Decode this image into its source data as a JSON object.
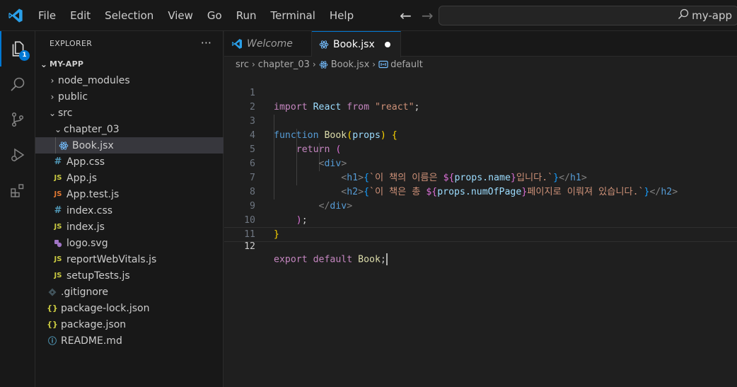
{
  "menu": [
    "File",
    "Edit",
    "Selection",
    "View",
    "Go",
    "Run",
    "Terminal",
    "Help"
  ],
  "command_center": "my-app",
  "activity": {
    "explorer_badge": "1"
  },
  "sidebar": {
    "title": "EXPLORER",
    "more": "···",
    "project": "MY-APP",
    "items": [
      {
        "name": "node_modules",
        "type": "folder",
        "icon": "chevron-right"
      },
      {
        "name": "public",
        "type": "folder",
        "icon": "chevron-right"
      },
      {
        "name": "src",
        "type": "folder-open",
        "icon": "chevron-down"
      },
      {
        "name": "chapter_03",
        "type": "folder-open",
        "icon": "chevron-down"
      },
      {
        "name": "Book.jsx",
        "type": "react-file",
        "icon": "react-icon",
        "selected": true
      },
      {
        "name": "App.css",
        "type": "css-file",
        "icon_text": "#"
      },
      {
        "name": "App.js",
        "type": "js-file",
        "icon_text": "JS"
      },
      {
        "name": "App.test.js",
        "type": "test-file",
        "icon_text": "JS"
      },
      {
        "name": "index.css",
        "type": "css-file",
        "icon_text": "#"
      },
      {
        "name": "index.js",
        "type": "js-file",
        "icon_text": "JS"
      },
      {
        "name": "logo.svg",
        "type": "svg-file",
        "icon": "svg-icon"
      },
      {
        "name": "reportWebVitals.js",
        "type": "js-file",
        "icon_text": "JS"
      },
      {
        "name": "setupTests.js",
        "type": "js-file",
        "icon_text": "JS"
      },
      {
        "name": ".gitignore",
        "type": "git-file",
        "icon": "git-icon"
      },
      {
        "name": "package-lock.json",
        "type": "json-file",
        "icon_text": "{}"
      },
      {
        "name": "package.json",
        "type": "json-file",
        "icon_text": "{}"
      },
      {
        "name": "README.md",
        "type": "info-file",
        "icon_text": "ⓘ"
      }
    ]
  },
  "tabs": [
    {
      "label": "Welcome",
      "active": false
    },
    {
      "label": "Book.jsx",
      "active": true,
      "dirty": true
    }
  ],
  "breadcrumb": [
    "src",
    "chapter_03",
    "Book.jsx",
    "default"
  ],
  "editor": {
    "line_numbers": [
      "1",
      "2",
      "3",
      "4",
      "5",
      "6",
      "7",
      "8",
      "9",
      "10",
      "11",
      "12"
    ],
    "current_line": "12",
    "lines": {
      "l1": {
        "import": "import",
        "react": "React",
        "from": "from",
        "str": "\"react\"",
        "semi": ";"
      },
      "l3": {
        "function": "function",
        "name": "Book",
        "open": "(",
        "param": "props",
        "close": ")",
        "brace": "{"
      },
      "l4": {
        "return": "return",
        "paren": "("
      },
      "l5": {
        "lt": "<",
        "tag": "div",
        "gt": ">"
      },
      "l6": {
        "lt": "<",
        "tag": "h1",
        "gt": ">",
        "ob": "{",
        "tick_open": "`이 책의 이름은 ",
        "interp_open": "${",
        "expr": "props.name",
        "interp_close": "}",
        "tick_close": "입니다.`",
        "cb": "}",
        "close_lt": "</",
        "close_tag": "h1",
        "close_gt": ">"
      },
      "l7": {
        "lt": "<",
        "tag": "h2",
        "gt": ">",
        "ob": "{",
        "tick_open": "`이 책은 총 ",
        "interp_open": "${",
        "expr": "props.numOfPage",
        "interp_close": "}",
        "tick_close": "페이지로 이뤄져 있습니다.`",
        "cb": "}",
        "close_lt": "</",
        "close_tag": "h2",
        "close_gt": ">"
      },
      "l8": {
        "lt": "</",
        "tag": "div",
        "gt": ">"
      },
      "l9": {
        "paren": ")",
        "semi": ";"
      },
      "l10": {
        "brace": "}"
      },
      "l12": {
        "export": "export",
        "default": "default",
        "name": "Book",
        "semi": ";"
      }
    }
  },
  "colors": {
    "accent": "#0078d4",
    "keyword": "#c586c0",
    "function_kw": "#569cd6",
    "string": "#ce9178",
    "identifier": "#9cdcfe",
    "function_name": "#dcdcaa"
  }
}
